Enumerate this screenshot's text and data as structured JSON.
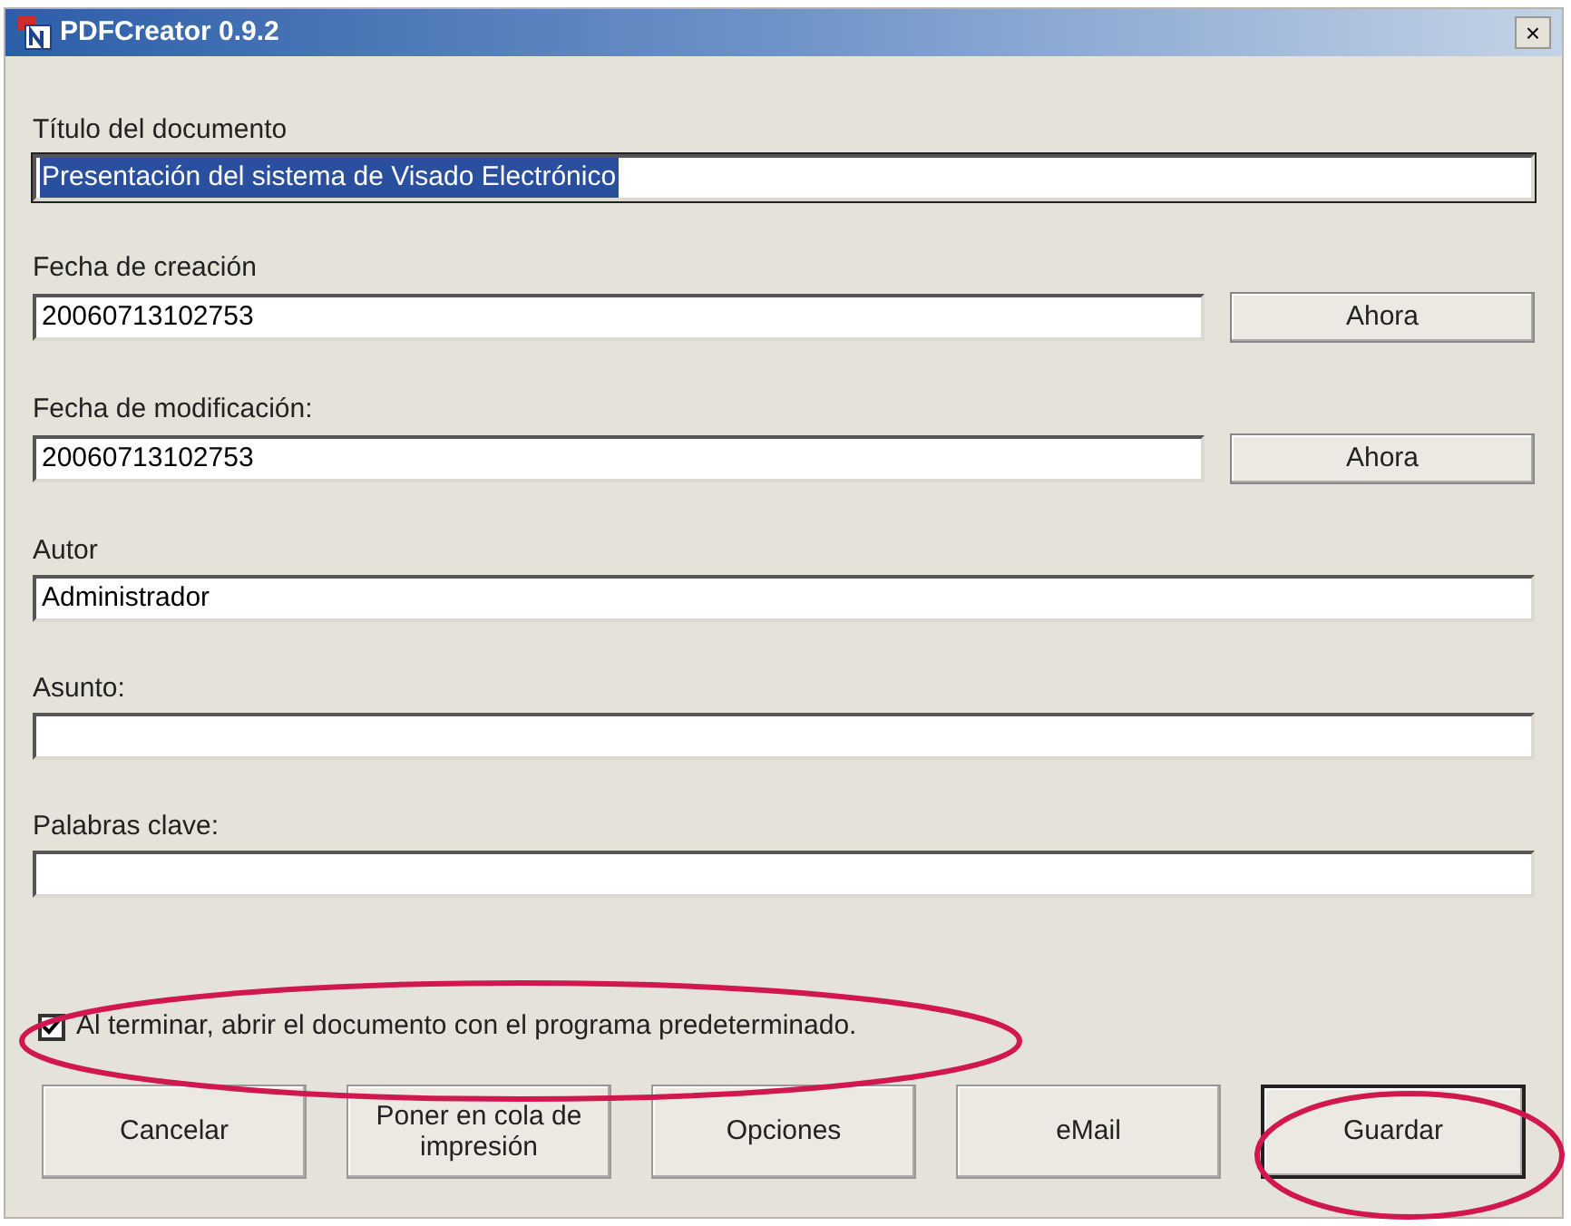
{
  "window": {
    "title": "PDFCreator 0.9.2",
    "close": "×"
  },
  "fields": [
    {
      "label": "Título del documento",
      "value": "Presentación del sistema de Visado Electrónico",
      "selected": true
    },
    {
      "label": "Fecha de creación",
      "value": "20060713102753",
      "selected": false,
      "button": "Ahora"
    },
    {
      "label": "Fecha de modificación:",
      "value": "20060713102753",
      "selected": false,
      "button": "Ahora"
    },
    {
      "label": "Autor",
      "value": "Administrador",
      "selected": false
    },
    {
      "label": "Asunto:",
      "selected": false
    },
    {
      "label": "Palabras clave:",
      "selected": false
    }
  ],
  "open_after": {
    "label": "Al terminar, abrir el documento con el programa predeterminado.",
    "checked": true
  },
  "buttons": [
    {
      "label": "Cancelar",
      "default": false
    },
    {
      "label": "Poner en cola de impresión",
      "default": false
    },
    {
      "label": "Opciones",
      "default": false
    },
    {
      "label": "eMail",
      "default": false
    },
    {
      "label": "Guardar",
      "default": true
    }
  ]
}
